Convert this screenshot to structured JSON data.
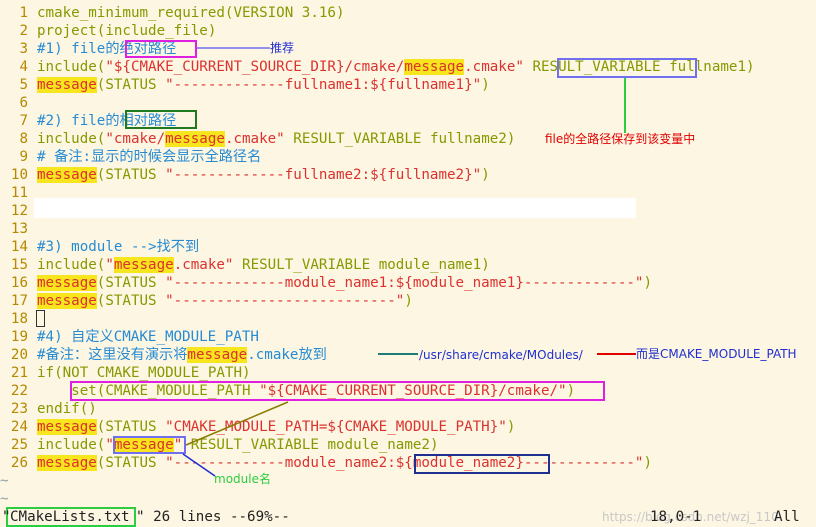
{
  "editor": {
    "lines": [
      {
        "n": "1",
        "segs": [
          {
            "t": "cmake_minimum_required(VERSION 3.16)",
            "c": "k"
          }
        ]
      },
      {
        "n": "2",
        "segs": [
          {
            "t": "project(include_file)",
            "c": "k"
          }
        ]
      },
      {
        "n": "3",
        "segs": [
          {
            "t": "#1) file的",
            "c": "c"
          },
          {
            "t": "绝对路径",
            "c": "c"
          }
        ]
      },
      {
        "n": "4",
        "segs": [
          {
            "t": "include(",
            "c": "k"
          },
          {
            "t": "\"${CMAKE_CURRENT_SOURCE_DIR}/cmake/",
            "c": "s"
          },
          {
            "t": "message",
            "c": "hl"
          },
          {
            "t": ".cmake\"",
            "c": "s"
          },
          {
            "t": " ",
            "c": ""
          },
          {
            "t": "RESULT_VARIABLE",
            "c": "k"
          },
          {
            "t": " fullname1)",
            "c": "k"
          }
        ]
      },
      {
        "n": "5",
        "segs": [
          {
            "t": "message",
            "c": "hl"
          },
          {
            "t": "(STATUS ",
            "c": "k"
          },
          {
            "t": "\"-------------fullname1:${fullname1}\"",
            "c": "s"
          },
          {
            "t": ")",
            "c": "k"
          }
        ]
      },
      {
        "n": "6",
        "segs": []
      },
      {
        "n": "7",
        "segs": [
          {
            "t": "#2) file的",
            "c": "c"
          },
          {
            "t": "相对路径",
            "c": "c"
          }
        ]
      },
      {
        "n": "8",
        "segs": [
          {
            "t": "include(",
            "c": "k"
          },
          {
            "t": "\"cmake/",
            "c": "s"
          },
          {
            "t": "message",
            "c": "hl"
          },
          {
            "t": ".cmake\"",
            "c": "s"
          },
          {
            "t": " RESULT_VARIABLE fullname2)",
            "c": "k"
          }
        ]
      },
      {
        "n": "9",
        "segs": [
          {
            "t": "# 备注:显示的时候会显示全路径名",
            "c": "c"
          }
        ]
      },
      {
        "n": "10",
        "segs": [
          {
            "t": "message",
            "c": "hl"
          },
          {
            "t": "(STATUS ",
            "c": "k"
          },
          {
            "t": "\"-------------fullname2:${fullname2}\"",
            "c": "s"
          },
          {
            "t": ")",
            "c": "k"
          }
        ]
      },
      {
        "n": "11",
        "segs": []
      },
      {
        "n": "12",
        "segs": []
      },
      {
        "n": "13",
        "segs": []
      },
      {
        "n": "14",
        "segs": [
          {
            "t": "#3) module -->找不到",
            "c": "c"
          }
        ]
      },
      {
        "n": "15",
        "segs": [
          {
            "t": "include(",
            "c": "k"
          },
          {
            "t": "\"",
            "c": "s"
          },
          {
            "t": "message",
            "c": "hl"
          },
          {
            "t": ".cmake\"",
            "c": "s"
          },
          {
            "t": " RESULT_VARIABLE module_name1)",
            "c": "k"
          }
        ]
      },
      {
        "n": "16",
        "segs": [
          {
            "t": "message",
            "c": "hl"
          },
          {
            "t": "(STATUS ",
            "c": "k"
          },
          {
            "t": "\"-------------module_name1:${module_name1}-------------\"",
            "c": "s"
          },
          {
            "t": ")",
            "c": "k"
          }
        ]
      },
      {
        "n": "17",
        "segs": [
          {
            "t": "message",
            "c": "hl"
          },
          {
            "t": "(STATUS ",
            "c": "k"
          },
          {
            "t": "\"--------------------------\"",
            "c": "s"
          },
          {
            "t": ")",
            "c": "k"
          }
        ]
      },
      {
        "n": "18",
        "segs": []
      },
      {
        "n": "19",
        "segs": [
          {
            "t": "#4) 自定义CMAKE_MODULE_PATH",
            "c": "c"
          }
        ]
      },
      {
        "n": "20",
        "segs": [
          {
            "t": "#备注：这里没有演示将",
            "c": "c"
          },
          {
            "t": "message",
            "c": "hl"
          },
          {
            "t": ".cmake放到",
            "c": "c"
          }
        ]
      },
      {
        "n": "21",
        "segs": [
          {
            "t": "if(NOT CMAKE_MODULE_PATH)",
            "c": "k"
          }
        ]
      },
      {
        "n": "22",
        "segs": [
          {
            "t": "    ",
            "c": ""
          },
          {
            "t": "set(CMAKE_MODULE_PATH ",
            "c": "k"
          },
          {
            "t": "\"${CMAKE_CURRENT_SOURCE_DIR}/cmake/\"",
            "c": "s"
          },
          {
            "t": ")",
            "c": "k"
          }
        ]
      },
      {
        "n": "23",
        "segs": [
          {
            "t": "endif()",
            "c": "k"
          }
        ]
      },
      {
        "n": "24",
        "segs": [
          {
            "t": "message",
            "c": "hl"
          },
          {
            "t": "(STATUS ",
            "c": "k"
          },
          {
            "t": "\"CMAKE_MODULE_PATH=${CMAKE_MODULE_PATH}\"",
            "c": "s"
          },
          {
            "t": ")",
            "c": "k"
          }
        ]
      },
      {
        "n": "25",
        "segs": [
          {
            "t": "include(",
            "c": "k"
          },
          {
            "t": "\"",
            "c": "s"
          },
          {
            "t": "message",
            "c": "hl"
          },
          {
            "t": "\"",
            "c": "s"
          },
          {
            "t": " RESULT_VARIABLE module_name2)",
            "c": "k"
          }
        ]
      },
      {
        "n": "26",
        "segs": [
          {
            "t": "message",
            "c": "hl"
          },
          {
            "t": "(STATUS ",
            "c": "k"
          },
          {
            "t": "\"-------------module_name2:${module_name2}-------------\"",
            "c": "s"
          },
          {
            "t": ")",
            "c": "k"
          }
        ]
      }
    ],
    "tildes": [
      "~",
      "~"
    ]
  },
  "annotations": {
    "recommended": "推荐",
    "saved_to_var": "file的全路径保存到该变量中",
    "usr_path": "/usr/share/cmake/MOdules/",
    "instead_module_path": "而是CMAKE_MODULE_PATH",
    "module_name": "module名"
  },
  "status": {
    "filename": "CMakeLists.txt",
    "info": "\" 26 lines --69%--",
    "position": "18,0-1",
    "scroll": "All",
    "watermark": "https://blog.csdn.net/wzj_110"
  },
  "colors": {
    "background": "#fdf6e3",
    "keyword": "#859900",
    "string": "#dc322f",
    "comment": "#268bd2",
    "highlight": "#f7e51e",
    "magenta_box": "#e020e0",
    "blue_box": "#6f6ff0",
    "green_box": "#2ecc40",
    "navy_box": "#1f2f8f"
  }
}
